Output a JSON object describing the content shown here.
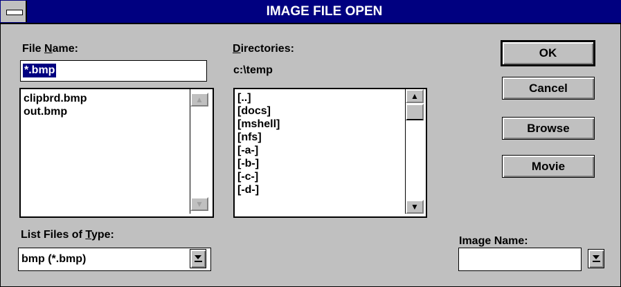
{
  "window": {
    "title": "IMAGE FILE OPEN"
  },
  "file_name": {
    "label_before": "File ",
    "label_underlined": "N",
    "label_after": "ame:",
    "value": "*.bmp",
    "files": [
      "clipbrd.bmp",
      "out.bmp"
    ]
  },
  "directories": {
    "label_underlined": "D",
    "label_after": "irectories:",
    "current_path": "c:\\temp",
    "items": [
      "[..]",
      "[docs]",
      "[mshell]",
      "[nfs]",
      "[-a-]",
      "[-b-]",
      "[-c-]",
      "[-d-]"
    ]
  },
  "buttons": {
    "ok": "OK",
    "cancel": "Cancel",
    "browse": "Browse",
    "movie": "Movie"
  },
  "file_type": {
    "label_before": "List Files of ",
    "label_underlined": "T",
    "label_after": "ype:",
    "value": "bmp (*.bmp)"
  },
  "image_name": {
    "label": "Image Name:",
    "value": ""
  },
  "icons": {
    "system_menu": "system-menu-icon",
    "scroll_up": "arrow-up-icon",
    "scroll_down": "arrow-down-icon",
    "dropdown": "dropdown-arrow-icon"
  },
  "colors": {
    "title_bar": "#000080",
    "face": "#c0c0c0",
    "selection": "#000080"
  }
}
